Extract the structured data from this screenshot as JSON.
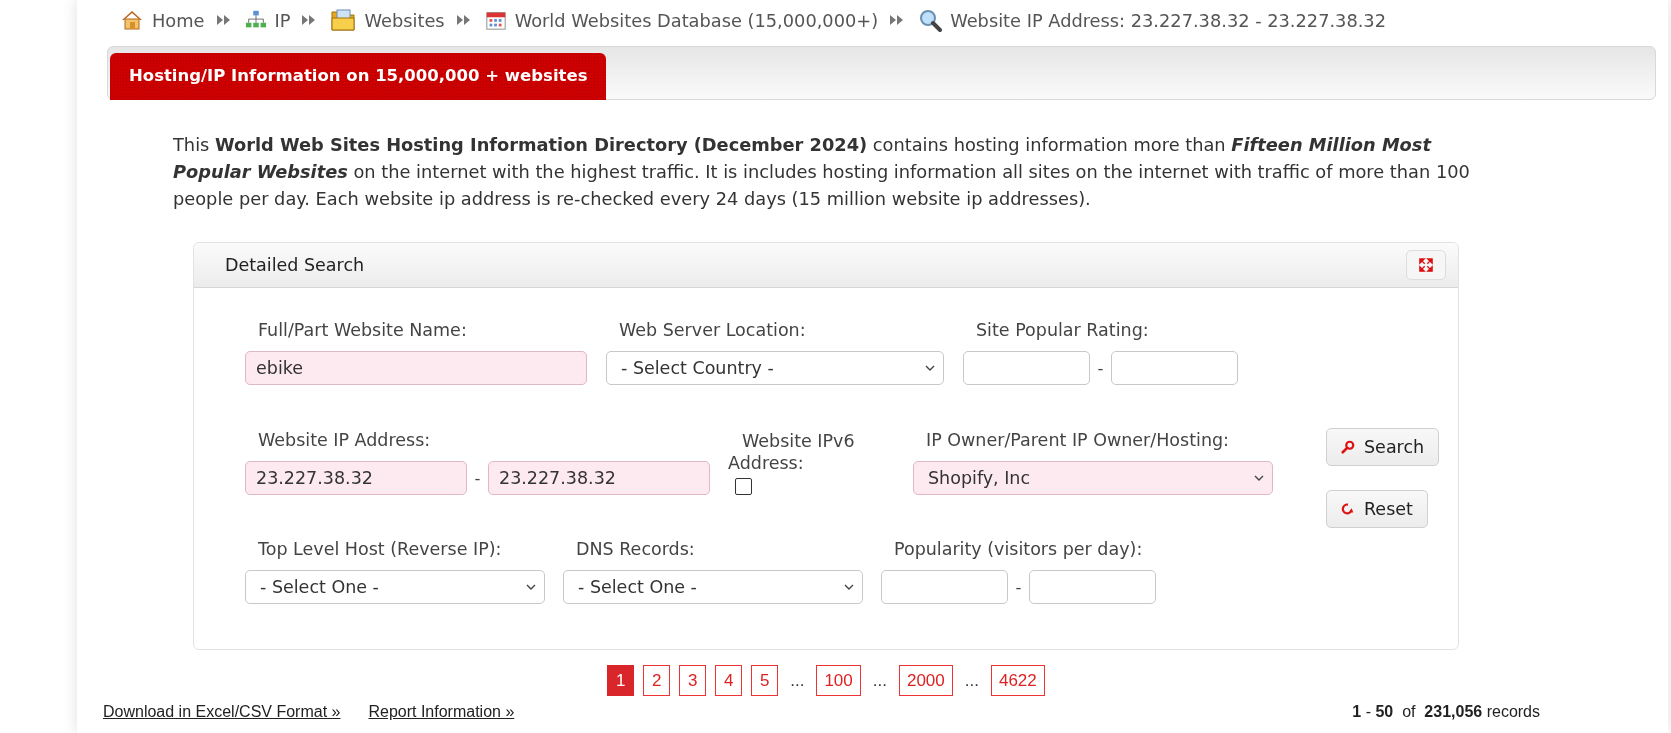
{
  "breadcrumb": [
    {
      "label": "Home"
    },
    {
      "label": "IP"
    },
    {
      "label": "Websites"
    },
    {
      "label": "World Websites Database (15,000,000+)"
    },
    {
      "label": "Website IP Address: 23.227.38.32 - 23.227.38.32"
    }
  ],
  "header_tab": {
    "label": "Hosting/IP Information on 15,000,000 + websites"
  },
  "intro": "This **World Web Sites Hosting Information Directory (December 2024)** contains hosting information more than *Fifteen Million Most Popular Websites* on the internet with the highest traffic. It is includes hosting information all sites on the internet with traffic of more than 100 people per day. Each website ip address is re-checked every 24 days (15 million website ip addresses).",
  "search_panel": {
    "title": "Detailed Search",
    "rows": [
      [
        {
          "kind": "text",
          "label": "Full/Part Website Name:",
          "value": "ebike",
          "highlighted": true
        },
        {
          "kind": "select",
          "label": "Web Server Location:",
          "value": "- Select Country -",
          "highlighted": false
        },
        {
          "kind": "range",
          "label": "Site Popular Rating:",
          "separator": "-",
          "highlighted": false
        }
      ],
      [
        {
          "kind": "range",
          "label": "Website IP Address:",
          "values": [
            "23.227.38.32",
            "23.227.38.32"
          ],
          "separator": "-",
          "highlighted": true
        },
        {
          "kind": "checkbox",
          "label": "Website IPv6 Address:",
          "checked": false
        },
        {
          "kind": "select",
          "label": "IP Owner/Parent IP Owner/Hosting:",
          "value": "Shopify, Inc",
          "highlighted": true
        }
      ],
      [
        {
          "kind": "select",
          "label": "Top Level Host (Reverse IP):",
          "value": "- Select One -",
          "highlighted": false
        },
        {
          "kind": "select",
          "label": "DNS Records:",
          "value": "- Select One -",
          "highlighted": false
        },
        {
          "kind": "range",
          "label": "Popularity (visitors per day):",
          "separator": "-",
          "highlighted": false
        }
      ]
    ],
    "buttons": [
      {
        "label": "Search"
      },
      {
        "label": "Reset"
      }
    ]
  },
  "pagination": [
    {
      "kind": "page",
      "label": "1",
      "selected": true
    },
    {
      "kind": "page",
      "label": "2",
      "selected": false
    },
    {
      "kind": "page",
      "label": "3",
      "selected": false
    },
    {
      "kind": "page",
      "label": "4",
      "selected": false
    },
    {
      "kind": "page",
      "label": "5",
      "selected": false
    },
    {
      "kind": "ellipsis",
      "label": "..."
    },
    {
      "kind": "page",
      "label": "100",
      "selected": false
    },
    {
      "kind": "ellipsis",
      "label": "..."
    },
    {
      "kind": "page",
      "label": "2000",
      "selected": false
    },
    {
      "kind": "ellipsis",
      "label": "..."
    },
    {
      "kind": "page",
      "label": "4622",
      "selected": false
    }
  ],
  "footer": {
    "links": [
      "Download in Excel/CSV Format »",
      "Report Information »"
    ],
    "records": "**1** - **50**  of  **231,056** records"
  }
}
